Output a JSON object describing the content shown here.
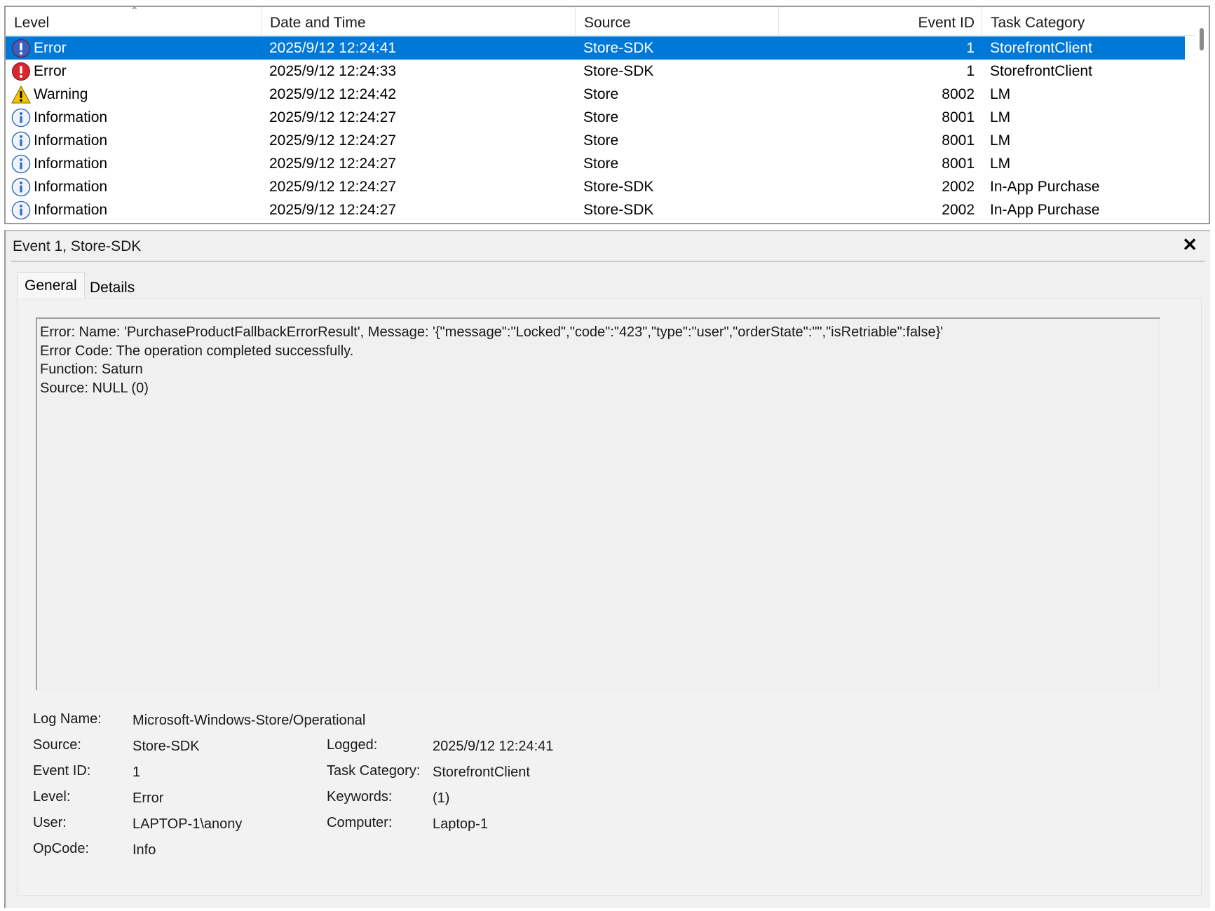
{
  "columns": {
    "level": "Level",
    "date_time": "Date and Time",
    "source": "Source",
    "event_id": "Event ID",
    "task_category": "Task Category"
  },
  "events": [
    {
      "level": "Error",
      "icon": "error-icon",
      "date": "2025/9/12 12:24:41",
      "source": "Store-SDK",
      "event_id": "1",
      "task": "StorefrontClient",
      "selected": true
    },
    {
      "level": "Error",
      "icon": "error-icon",
      "date": "2025/9/12 12:24:33",
      "source": "Store-SDK",
      "event_id": "1",
      "task": "StorefrontClient"
    },
    {
      "level": "Warning",
      "icon": "warning-icon",
      "date": "2025/9/12 12:24:42",
      "source": "Store",
      "event_id": "8002",
      "task": "LM"
    },
    {
      "level": "Information",
      "icon": "info-icon",
      "date": "2025/9/12 12:24:27",
      "source": "Store",
      "event_id": "8001",
      "task": "LM"
    },
    {
      "level": "Information",
      "icon": "info-icon",
      "date": "2025/9/12 12:24:27",
      "source": "Store",
      "event_id": "8001",
      "task": "LM"
    },
    {
      "level": "Information",
      "icon": "info-icon",
      "date": "2025/9/12 12:24:27",
      "source": "Store",
      "event_id": "8001",
      "task": "LM"
    },
    {
      "level": "Information",
      "icon": "info-icon",
      "date": "2025/9/12 12:24:27",
      "source": "Store-SDK",
      "event_id": "2002",
      "task": "In-App Purchase"
    },
    {
      "level": "Information",
      "icon": "info-icon",
      "date": "2025/9/12 12:24:27",
      "source": "Store-SDK",
      "event_id": "2002",
      "task": "In-App Purchase"
    }
  ],
  "detail": {
    "title": "Event 1, Store-SDK",
    "tabs": [
      "General",
      "Details"
    ],
    "message_lines": [
      "Error: Name: 'PurchaseProductFallbackErrorResult', Message: '{\"message\":\"Locked\",\"code\":\"423\",\"type\":\"user\",\"orderState\":\"\",\"isRetriable\":false}'",
      "Error Code: The operation completed successfully.",
      "Function: Saturn",
      "Source: NULL (0)"
    ],
    "props": {
      "log_name_label": "Log Name:",
      "log_name": "Microsoft-Windows-Store/Operational",
      "source_label": "Source:",
      "source": "Store-SDK",
      "logged_label": "Logged:",
      "logged": "2025/9/12 12:24:41",
      "event_id_label": "Event ID:",
      "event_id": "1",
      "task_category_label": "Task Category:",
      "task_category": "StorefrontClient",
      "level_label": "Level:",
      "level": "Error",
      "keywords_label": "Keywords:",
      "keywords": "(1)",
      "user_label": "User:",
      "user": "LAPTOP-1\\anony",
      "computer_label": "Computer:",
      "computer": "Laptop-1",
      "opcode_label": "OpCode:",
      "opcode": "Info"
    }
  },
  "colors": {
    "selection": "#0078d7",
    "error": "#d9262e",
    "warning": "#f5c400",
    "info": "#3a6fc4"
  }
}
